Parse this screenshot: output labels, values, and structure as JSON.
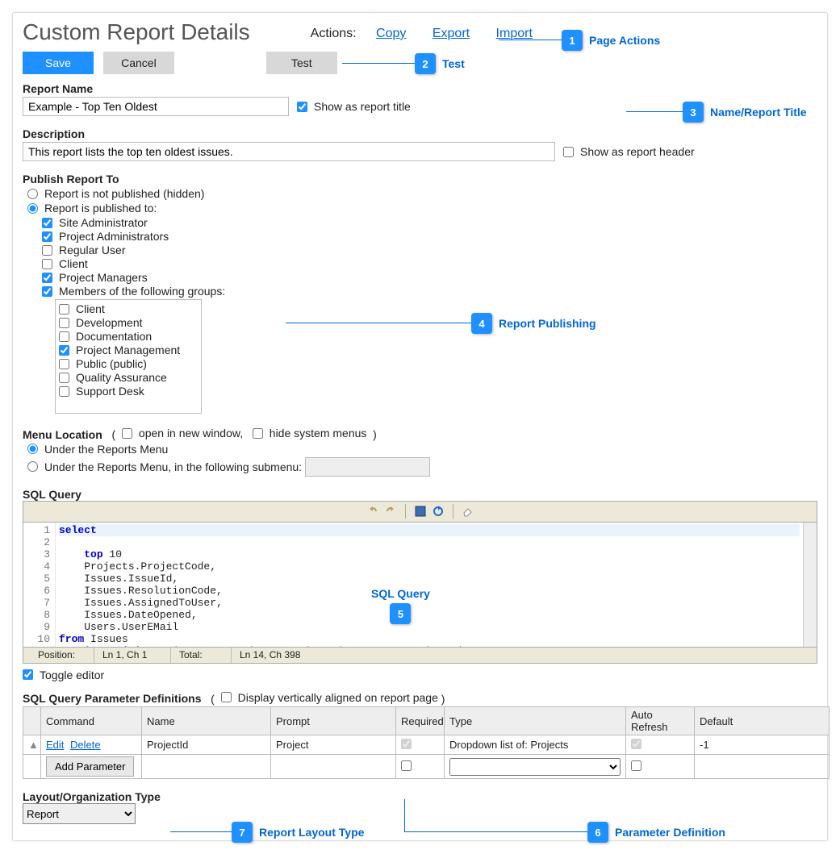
{
  "title": "Custom Report Details",
  "actionsLabel": "Actions:",
  "actions": {
    "copy": "Copy",
    "export": "Export",
    "import": "Import"
  },
  "buttons": {
    "save": "Save",
    "cancel": "Cancel",
    "test": "Test"
  },
  "reportName": {
    "label": "Report Name",
    "value": "Example - Top Ten Oldest",
    "showAsTitle": "Show as report title",
    "showAsTitleChecked": true
  },
  "description": {
    "label": "Description",
    "value": "This report lists the top ten oldest issues.",
    "showAsHeader": "Show as report header",
    "showAsHeaderChecked": false
  },
  "publish": {
    "label": "Publish Report To",
    "notPublished": "Report is not published (hidden)",
    "publishedTo": "Report is published to:",
    "selected": "publishedTo",
    "roles": [
      {
        "label": "Site Administrator",
        "checked": true
      },
      {
        "label": "Project Administrators",
        "checked": true
      },
      {
        "label": "Regular User",
        "checked": false
      },
      {
        "label": "Client",
        "checked": false
      },
      {
        "label": "Project Managers",
        "checked": true
      }
    ],
    "membersLabel": "Members of the following groups:",
    "membersChecked": true,
    "groups": [
      {
        "label": "Client",
        "checked": false
      },
      {
        "label": "Development",
        "checked": false
      },
      {
        "label": "Documentation",
        "checked": false
      },
      {
        "label": "Project Management",
        "checked": true
      },
      {
        "label": "Public (public)",
        "checked": false
      },
      {
        "label": "Quality Assurance",
        "checked": false
      },
      {
        "label": "Support Desk",
        "checked": false
      }
    ]
  },
  "menuLocation": {
    "label": "Menu Location",
    "openNew": "open in new window,",
    "hideSys": "hide system menus",
    "opt1": "Under the Reports Menu",
    "opt2": "Under the Reports Menu, in the following submenu:",
    "selected": "opt1"
  },
  "sql": {
    "label": "SQL Query",
    "lines": [
      {
        "n": "1",
        "html": "<span class='kw'>select</span>"
      },
      {
        "n": "2",
        "html": "    <span class='kw'>top</span> 10"
      },
      {
        "n": "3",
        "html": "    Projects.ProjectCode,"
      },
      {
        "n": "4",
        "html": "    Issues.IssueId,"
      },
      {
        "n": "5",
        "html": "    Issues.ResolutionCode,"
      },
      {
        "n": "6",
        "html": "    Issues.AssignedToUser,"
      },
      {
        "n": "7",
        "html": "    Issues.DateOpened,"
      },
      {
        "n": "8",
        "html": "    Users.UserEMail"
      },
      {
        "n": "9",
        "html": "<span class='kw'>from</span> Issues"
      },
      {
        "n": "10",
        "html": "    <span class='kw'>inner</span> <span class='kw'>join</span> Projects <span class='kw'>on</span> Projects.ProjectId = Issues.ProjectId"
      }
    ],
    "status": {
      "posLabel": "Position:",
      "pos": "Ln 1, Ch 1",
      "totLabel": "Total:",
      "tot": "Ln 14, Ch 398"
    },
    "toggle": "Toggle editor",
    "toggleChecked": true
  },
  "params": {
    "label": "SQL Query Parameter Definitions",
    "displayVert": "Display vertically aligned on report page",
    "headers": {
      "cmd": "Command",
      "name": "Name",
      "prompt": "Prompt",
      "req": "Required",
      "type": "Type",
      "auto": "Auto Refresh",
      "def": "Default"
    },
    "row": {
      "edit": "Edit",
      "delete": "Delete",
      "name": "ProjectId",
      "prompt": "Project",
      "required": true,
      "type": "Dropdown list of: Projects",
      "autoRefresh": true,
      "default": "-1"
    },
    "addBtn": "Add Parameter"
  },
  "layout": {
    "label": "Layout/Organization Type",
    "value": "Report"
  },
  "annotations": {
    "1": "Page Actions",
    "2": "Test",
    "3": "Name/Report Title",
    "4": "Report Publishing",
    "5": "SQL Query",
    "6": "Parameter Definition",
    "7": "Report Layout Type"
  }
}
